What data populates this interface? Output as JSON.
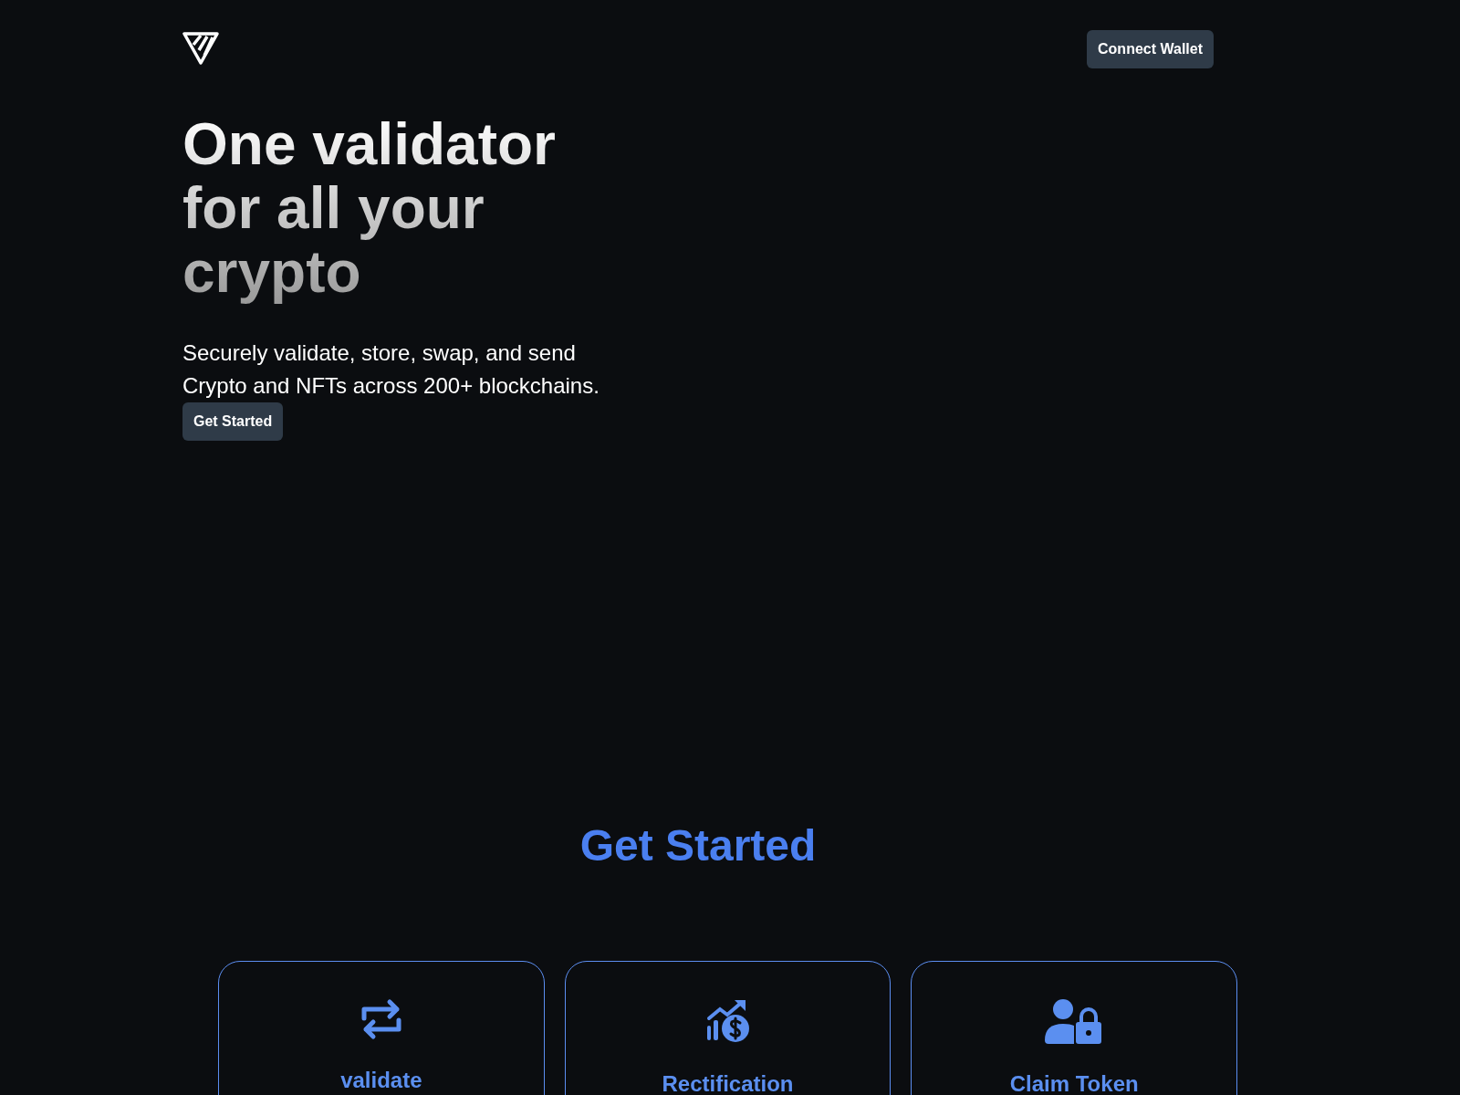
{
  "header": {
    "button": "Connect Wallet"
  },
  "hero": {
    "title": "One validator for all your crypto",
    "subtitle": "Securely validate, store, swap, and send Crypto and NFTs across 200+ blockchains.",
    "button": "Get Started"
  },
  "section": {
    "title": "Get Started",
    "cards": [
      {
        "title": "validate"
      },
      {
        "title": "Rectification"
      },
      {
        "title": "Claim Token"
      }
    ]
  }
}
